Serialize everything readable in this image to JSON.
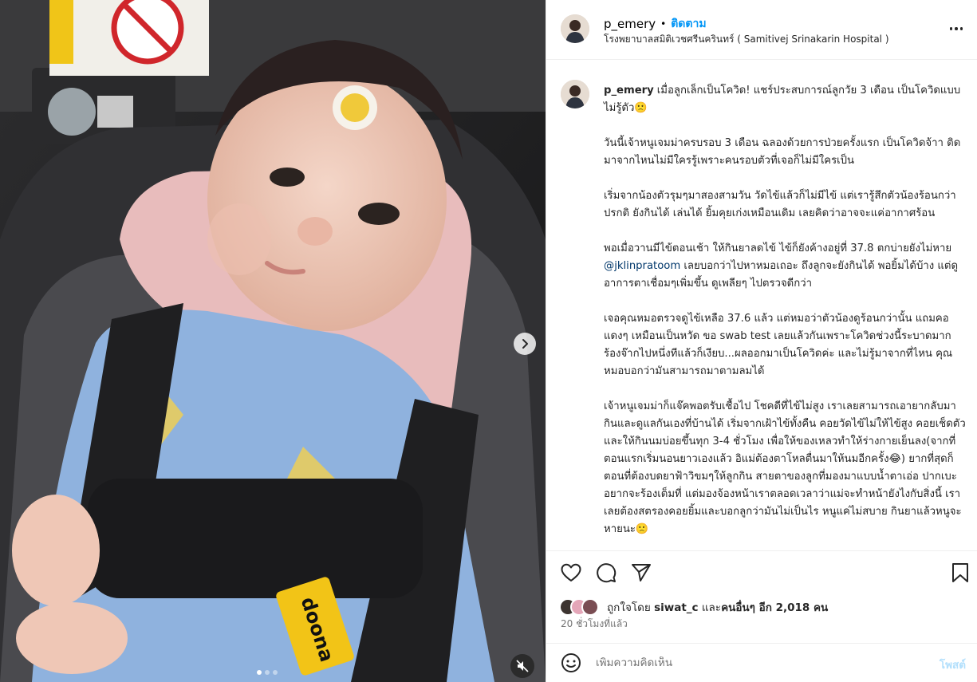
{
  "header": {
    "username": "p_emery",
    "separator": "•",
    "follow_label": "ติดตาม",
    "location": "โรงพยาบาลสมิติเวชศรีนครินทร์ ( Samitivej Srinakarin Hospital )"
  },
  "caption": {
    "username": "p_emery",
    "intro": "เมื่อลูกเล็กเป็นโควิด! แชร์ประสบการณ์ลูกวัย 3 เดือน เป็นโควิดแบบไม่รู้ตัว🙁",
    "p1": "วันนี้เจ้าหนูเจมม่าครบรอบ 3 เดือน ฉลองด้วยการป่วยครั้งแรก เป็นโควิดจ้าา ติดมาจากไหนไม่มีใครรู้เพราะคนรอบตัวที่เจอก็ไม่มีใครเป็น",
    "p2": "เริ่มจากน้องตัวรุมๆมาสองสามวัน วัดไข้แล้วก็ไม่มีไข้ แต่เรารู้สึกตัวน้องร้อนกว่าปรกติ ยังกินได้ เล่นได้ ยิ้มคุยเก่งเหมือนเดิม เลยคิดว่าอาจจะแค่อากาศร้อน",
    "p3_a": "พอเมื่อวานมีไข้ตอนเช้า ให้กินยาลดไข้ ไข้ก็ยังค้างอยู่ที่ 37.8 ตกบ่ายยังไม่หาย ",
    "p3_mention": "@jklinpratoom",
    "p3_b": " เลยบอกว่าไปหาหมอเถอะ ถึงลูกจะยังกินได้ พอยิ้มได้บ้าง แต่ดูอาการตาเชื่อมๆเพิ่มขึ้น ดูเพลียๆ ไปตรวจดีกว่า",
    "p4": "เจอคุณหมอตรวจดูไข้เหลือ 37.6 แล้ว แต่หมอว่าตัวน้องดูร้อนกว่านั้น แถมคอแดงๆ เหมือนเป็นหวัด ขอ swab test เลยแล้วกันเพราะโควิดช่วงนี้ระบาดมาก ร้องจ๊ากไปหนึ่งทีแล้วก็เงียบ...ผลออกมาเป็นโควิดค่ะ และไม่รู้มาจากที่ไหน คุณหมอบอกว่ามันสามารถมาตามลมได้",
    "p5": "เจ้าหนูเจมม่าก็แจ๊คพอตรับเชื้อไป โชคดีที่ไข้ไม่สูง เราเลยสามารถเอายากลับมากินและดูแลกันเองที่บ้านได้ เริ่มจากเฝ้าไข้ทั้งคืน คอยวัดไข้ไม่ให้ไข้สูง คอยเช็ดตัว และให้กินนมบ่อยขึ้นทุก 3-4 ชั่วโมง เพื่อให้ของเหลวทำให้ร่างกายเย็นลง(จากที่ตอนแรกเริ่มนอนยาวเองแล้ว อิแม่ต้องตาโหลตื่นมาให้นมอีกครั้ง😂) ยากที่สุดก็ตอนที่ต้องบดยาฟ้าวิขมๆให้ลูกกิน สายตาของลูกที่มองมาแบบน้ำตาเอ่อ ปากเบะอยากจะร้องเต็มที่ แต่มองจ้องหน้าเราตลอดเวลาว่าแม่จะทำหน้ายังไงกับสิ่งนี้ เราเลยต้องสตรองคอยยิ้มและบอกลูกว่ามันไม่เป็นไร หนูแค่ไม่สบาย กินยาแล้วหนูจะหายนะ🙁"
  },
  "likes": {
    "prefix": "ถูกใจโดย ",
    "user": "siwat_c",
    "middle": " และ",
    "others": "คนอื่นๆ อีก 2,018 คน"
  },
  "time": "20 ชั่วโมงที่แล้ว",
  "comment": {
    "placeholder": "เพิ่มความคิดเห็น",
    "post_label": "โพสต์"
  },
  "media": {
    "slides_total": 3,
    "active_slide": 1
  },
  "colors": {
    "accent": "#0095f6",
    "mention": "#00376b",
    "muted": "#737373",
    "post_disabled": "#b2dffc"
  }
}
